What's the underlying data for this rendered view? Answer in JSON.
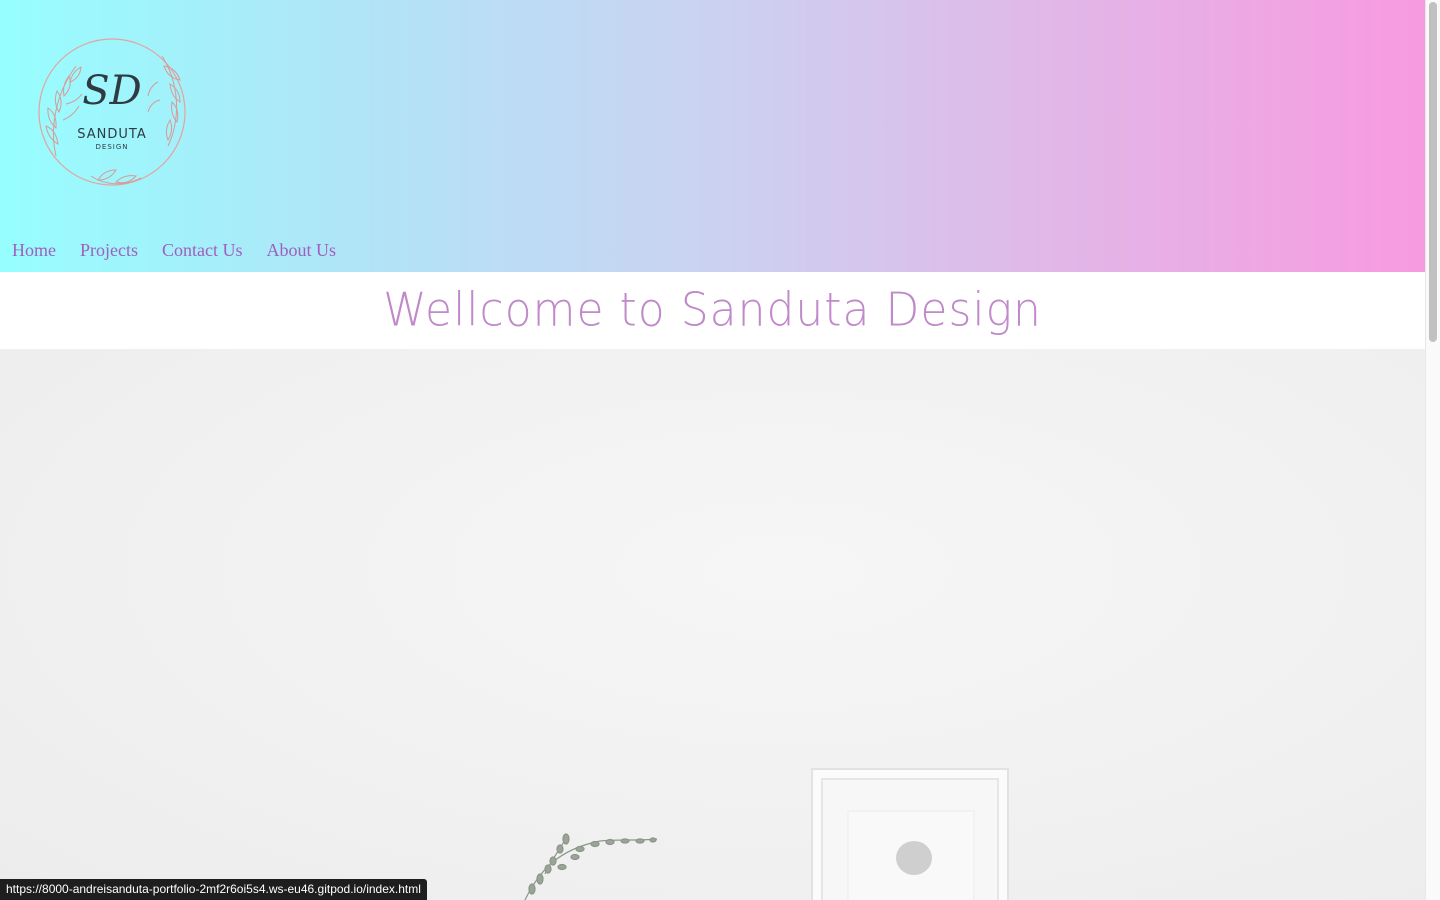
{
  "logo": {
    "monogram": "SD",
    "name": "SANDUTA",
    "tagline": "DESIGN"
  },
  "nav": {
    "items": [
      {
        "label": "Home"
      },
      {
        "label": "Projects"
      },
      {
        "label": "Contact Us"
      },
      {
        "label": "About Us"
      }
    ]
  },
  "welcome": {
    "title": "Wellcome to Sanduta Design"
  },
  "status_bar": {
    "url": "https://8000-andreisanduta-portfolio-2mf2r6oi5s4.ws-eu46.gitpod.io/index.html"
  },
  "colors": {
    "nav_link": "#a05fbf",
    "title": "#c089c9",
    "gradient_start": "#96fefe",
    "gradient_end": "#f89ae0"
  }
}
